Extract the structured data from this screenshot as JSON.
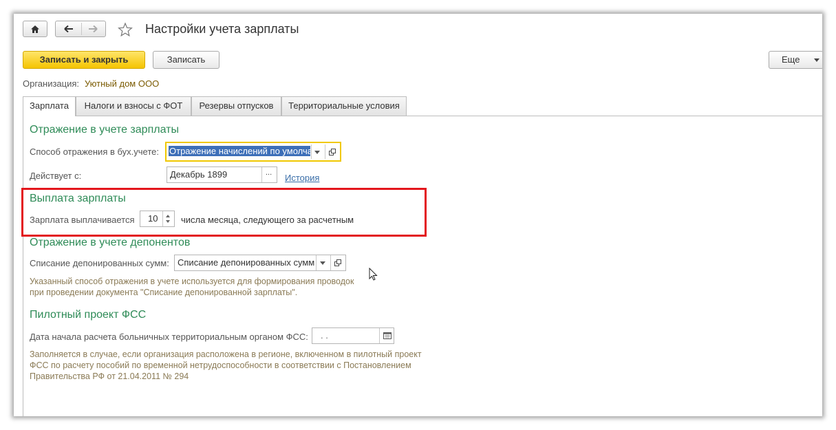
{
  "window": {
    "title": "Настройки учета зарплаты"
  },
  "toolbar": {
    "save_close_label": "Записать и закрыть",
    "save_label": "Записать",
    "more_label": "Еще"
  },
  "organization": {
    "label": "Организация:",
    "value": "Уютный дом ООО"
  },
  "tabs": [
    {
      "label": "Зарплата",
      "active": true
    },
    {
      "label": "Налоги и взносы с ФОТ",
      "active": false
    },
    {
      "label": "Резервы отпусков",
      "active": false
    },
    {
      "label": "Территориальные условия",
      "active": false
    }
  ],
  "accounting": {
    "title": "Отражение в учете зарплаты",
    "method_label": "Способ отражения в бух.учете:",
    "method_value": "Отражение начислений по умолча",
    "effective_label": "Действует с:",
    "effective_value": "Декабрь 1899",
    "ellipsis": "...",
    "history_link": "История"
  },
  "payment": {
    "title": "Выплата зарплаты",
    "paid_label": "Зарплата выплачивается",
    "day_value": "10",
    "suffix": "числа месяца, следующего за расчетным"
  },
  "deposits": {
    "title": "Отражение в учете депонентов",
    "writeoff_label": "Списание депонированных сумм:",
    "writeoff_value": "Списание депонированных сумм",
    "hint_line1": "Указанный способ отражения в учете используется для формирования проводок",
    "hint_line2": "при проведении документа \"Списание депонированной зарплаты\"."
  },
  "fss": {
    "title": "Пилотный проект ФСС",
    "date_label": "Дата начала расчета больничных территориальным органом ФСС:",
    "date_value": ".  .",
    "hint_line1": "Заполняется в случае, если организация расположена в регионе, включенном в пилотный проект",
    "hint_line2": "ФСС по расчету пособий по временной нетрудоспособности в соответствии с Постановлением",
    "hint_line3": "Правительства РФ от 21.04.2011 № 294"
  },
  "colors": {
    "accent_green": "#2e8b57",
    "highlight_red": "#e3161c",
    "primary_yellow": "#f5c400"
  },
  "icons": [
    "home-icon",
    "back-arrow-icon",
    "forward-arrow-icon",
    "star-icon",
    "dropdown-icon",
    "open-icon",
    "calendar-icon",
    "spin-up-icon",
    "spin-down-icon",
    "cursor-icon"
  ]
}
